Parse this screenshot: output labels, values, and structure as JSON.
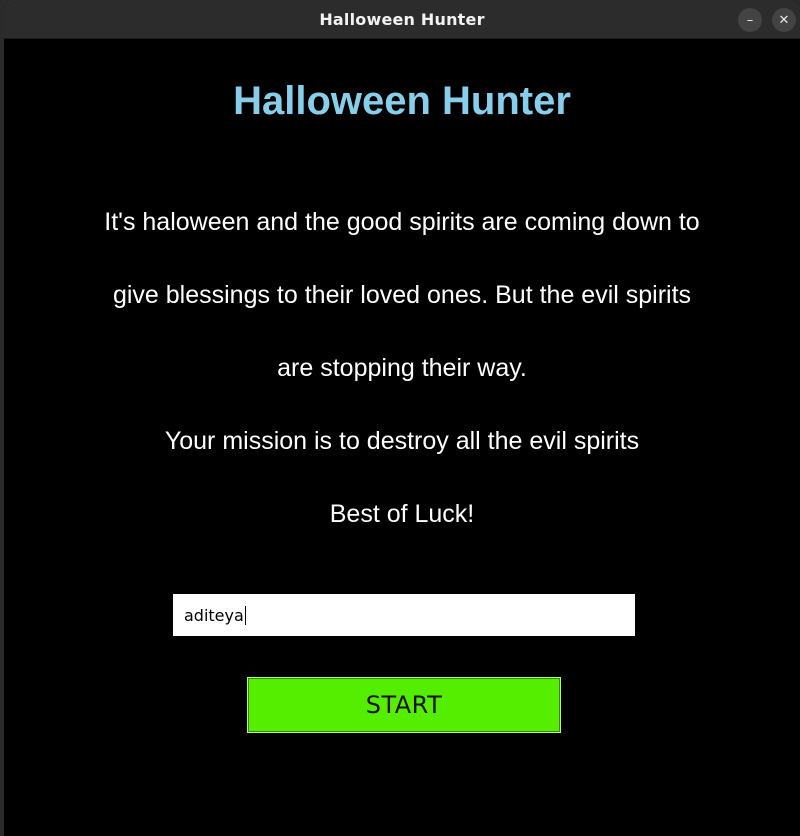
{
  "window": {
    "title": "Halloween Hunter",
    "minimize_glyph": "–",
    "close_glyph": "✕"
  },
  "game": {
    "heading": "Halloween Hunter",
    "lines": [
      "It's haloween and the good spirits are coming down to",
      "give blessings to their loved ones. But the evil spirits",
      "are stopping their way.",
      "Your mission is to destroy all the evil spirits",
      "Best of Luck!"
    ],
    "name_input": {
      "value": "aditeya"
    },
    "start_label": "START"
  },
  "colors": {
    "background": "#000000",
    "heading": "#87ceeb",
    "text": "#ffffff",
    "start_button": "#55ee00"
  }
}
